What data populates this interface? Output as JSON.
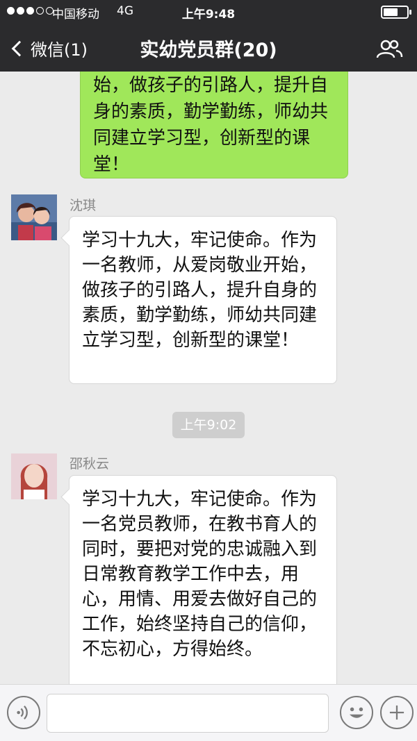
{
  "status_bar": {
    "carrier": "中国移动",
    "network": "4G",
    "time": "上午9:48",
    "battery_level": 0.6
  },
  "nav": {
    "back_label": "微信(1)",
    "title": "实幼党员群(20)"
  },
  "messages": {
    "own_partial": {
      "text": "始，做孩子的引路人，提升自身的素质，勤学勤练，师幼共同建立学习型，创新型的课堂！"
    },
    "msg1": {
      "sender": "沈琪",
      "text": "学习十九大，牢记使命。作为一名教师，从爱岗敬业开始，做孩子的引路人，提升自身的素质，勤学勤练，师幼共同建立学习型，创新型的课堂！"
    },
    "timestamp": "上午9:02",
    "msg2": {
      "sender": "邵秋云",
      "text": "学习十九大，牢记使命。作为一名党员教师，在教书育人的同时，要把对党的忠诚融入到日常教育教学工作中去，用心，用情、用爱去做好自己的工作，始终坚持自己的信仰，不忘初心，方得始终。"
    }
  },
  "input_bar": {
    "voice_icon": "voice-icon",
    "emoji_icon": "emoji-icon",
    "add_icon": "plus-icon"
  },
  "colors": {
    "topbar": "#2b2b2d",
    "own_bubble": "#a0e75a",
    "chat_bg": "#ebebeb"
  }
}
